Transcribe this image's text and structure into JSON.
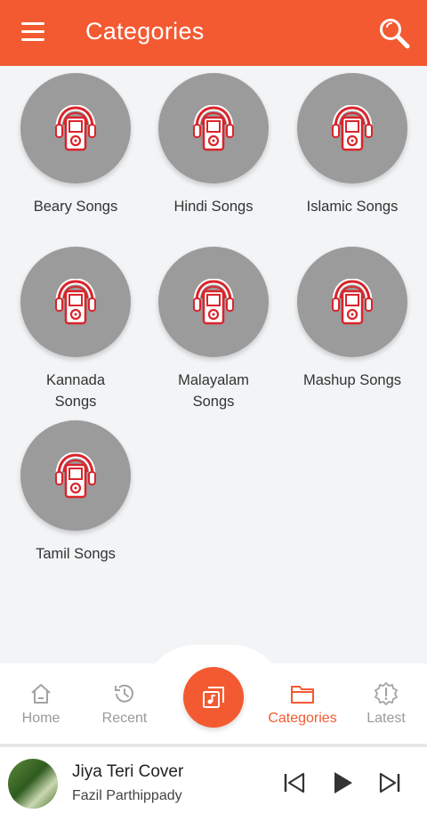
{
  "header": {
    "title": "Categories",
    "menu_icon": "hamburger-menu-icon",
    "search_icon": "search-icon"
  },
  "categories": [
    {
      "label": "Beary Songs",
      "icon": "music-player-headphones-icon"
    },
    {
      "label": "Hindi Songs",
      "icon": "music-player-headphones-icon"
    },
    {
      "label": "Islamic Songs",
      "icon": "music-player-headphones-icon"
    },
    {
      "label": "Kannada Songs",
      "icon": "music-player-headphones-icon"
    },
    {
      "label": "Malayalam Songs",
      "icon": "music-player-headphones-icon"
    },
    {
      "label": "Mashup Songs",
      "icon": "music-player-headphones-icon"
    },
    {
      "label": "Tamil Songs",
      "icon": "music-player-headphones-icon"
    }
  ],
  "bottom_nav": {
    "items": [
      {
        "label": "Home",
        "icon": "home-icon",
        "active": false
      },
      {
        "label": "Recent",
        "icon": "history-icon",
        "active": false
      },
      {
        "label": "Categories",
        "icon": "folder-icon",
        "active": true
      },
      {
        "label": "Latest",
        "icon": "latest-badge-icon",
        "active": false
      }
    ],
    "center_icon": "music-library-icon"
  },
  "now_playing": {
    "title": "Jiya Teri Cover",
    "artist": "Fazil Parthippady",
    "controls": [
      "skip-previous-icon",
      "play-icon",
      "skip-next-icon"
    ]
  },
  "colors": {
    "accent": "#f35a31",
    "circle": "#9b9b9b",
    "icon_red": "#d9242b",
    "background": "#f2f4f6"
  }
}
